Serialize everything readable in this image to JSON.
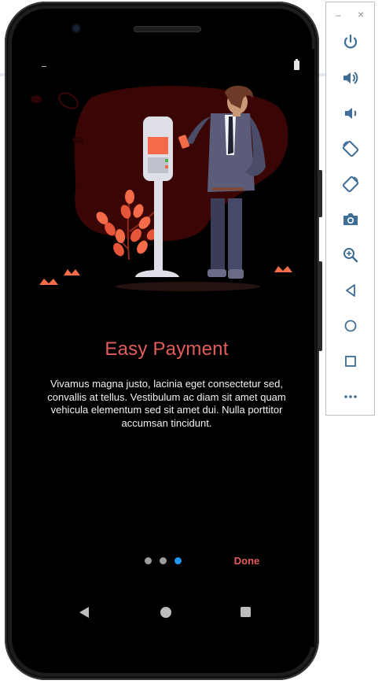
{
  "screen": {
    "title": "Easy Payment",
    "body": "Vivamus magna justo, lacinia eget consectetur sed, convallis at tellus. Vestibulum ac diam sit amet quam vehicula elementum sed sit amet dui. Nulla porttitor accumsan tincidunt.",
    "done_label": "Done",
    "pager": {
      "count": 3,
      "active_index": 2
    }
  },
  "colors": {
    "accent": "#e35d5d",
    "dot_active": "#2196f3",
    "dot_inactive": "#9e9e9e",
    "background": "#000000"
  },
  "toolbar": {
    "minimize_glyph": "–",
    "close_glyph": "×",
    "items": [
      "power-icon",
      "volume-up-icon",
      "volume-down-icon",
      "rotate-left-icon",
      "rotate-right-icon",
      "camera-icon",
      "zoom-icon",
      "back-icon",
      "home-icon",
      "overview-icon",
      "more-icon"
    ]
  },
  "navigation": [
    "back-icon",
    "home-icon",
    "recents-icon"
  ]
}
